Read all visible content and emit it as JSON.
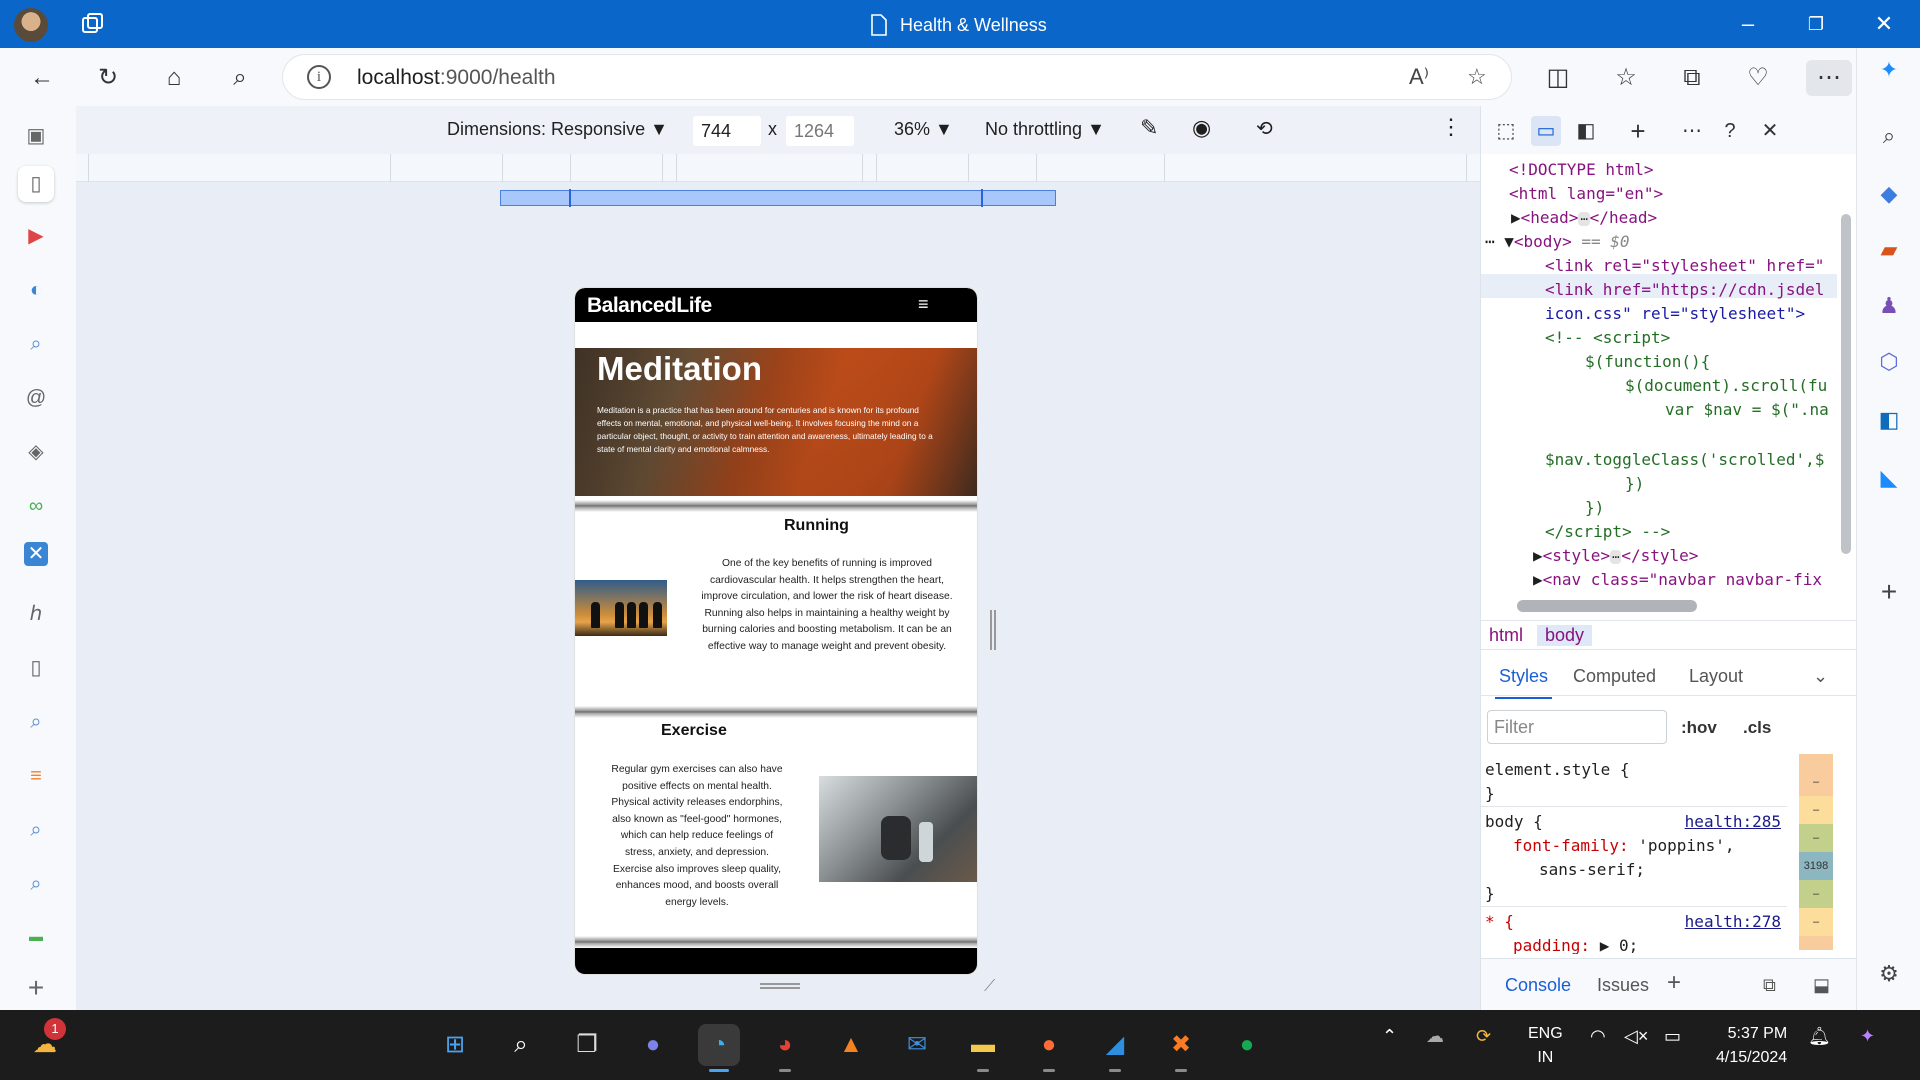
{
  "window": {
    "title": "Health & Wellness"
  },
  "address": {
    "host": "localhost",
    "port_path": ":9000/health"
  },
  "device_toolbar": {
    "dimensions_label": "Dimensions: Responsive",
    "width_value": "744",
    "height_value": "1264",
    "times": "x",
    "zoom": "36%",
    "throttling": "No throttling"
  },
  "site": {
    "brand": "BalancedLife",
    "hamburger": "≡",
    "hero_title": "Meditation",
    "hero_text": "Meditation is a practice that has been around for centuries and is known for its profound effects on mental, emotional, and physical well-being. It involves focusing the mind on a particular object, thought, or activity to train attention and awareness, ultimately leading to a state of mental clarity and emotional calmness.",
    "running_title": "Running",
    "running_text": "One of the key benefits of running is improved cardiovascular health. It helps strengthen the heart, improve circulation, and lower the risk of heart disease. Running also helps in maintaining a healthy weight by burning calories and boosting metabolism. It can be an effective way to manage weight and prevent obesity.",
    "exercise_title": "Exercise",
    "exercise_text": "Regular gym exercises can also have positive effects on mental health. Physical activity releases endorphins, also known as \"feel-good\" hormones, which can help reduce feelings of stress, anxiety, and depression. Exercise also improves sleep quality, enhances mood, and boosts overall energy levels."
  },
  "devtools": {
    "dom_lines": [
      "<!DOCTYPE html>",
      "<html lang=\"en\">",
      "<head>",
      "</head>",
      "<body>",
      "== $0",
      "<link rel=\"stylesheet\" href=\"",
      "<link href=\"https://cdn.jsdel",
      "icon.css\" rel=\"stylesheet\">",
      "<!-- <script>",
      "$(function(){",
      "$(document).scroll(fu",
      "var $nav = $(\".na",
      "$nav.toggleClass('scrolled',$",
      "})",
      "})",
      "</script> -->",
      "<style>",
      "</style>",
      "<nav class=\"navbar navbar-fix"
    ],
    "crumbs": [
      "html",
      "body"
    ],
    "style_tabs": [
      "Styles",
      "Computed",
      "Layout"
    ],
    "filter_placeholder": "Filter",
    "hov": ":hov",
    "cls": ".cls",
    "rules": {
      "element_style": "element.style {",
      "close": "}",
      "body_selector": "body {",
      "body_link": "health:285",
      "font_family_prop": "font-family:",
      "font_family_val": "'poppins',",
      "font_family_val2": "sans-serif;",
      "star_selector": "* {",
      "star_link": "health:278",
      "padding_prop": "padding:",
      "padding_val": "0;"
    },
    "box_model_values": [
      "–",
      "–",
      "–",
      "3198",
      "–",
      "–"
    ],
    "drawer_tabs": [
      "Console",
      "Issues"
    ]
  },
  "taskbar": {
    "notification_count": "1",
    "lang_top": "ENG",
    "lang_bottom": "IN",
    "time": "5:37 PM",
    "date": "4/15/2024"
  },
  "colors": {
    "titlebar": "#0a66c8",
    "accent": "#1a5fd6",
    "site_nav": "#000000"
  }
}
